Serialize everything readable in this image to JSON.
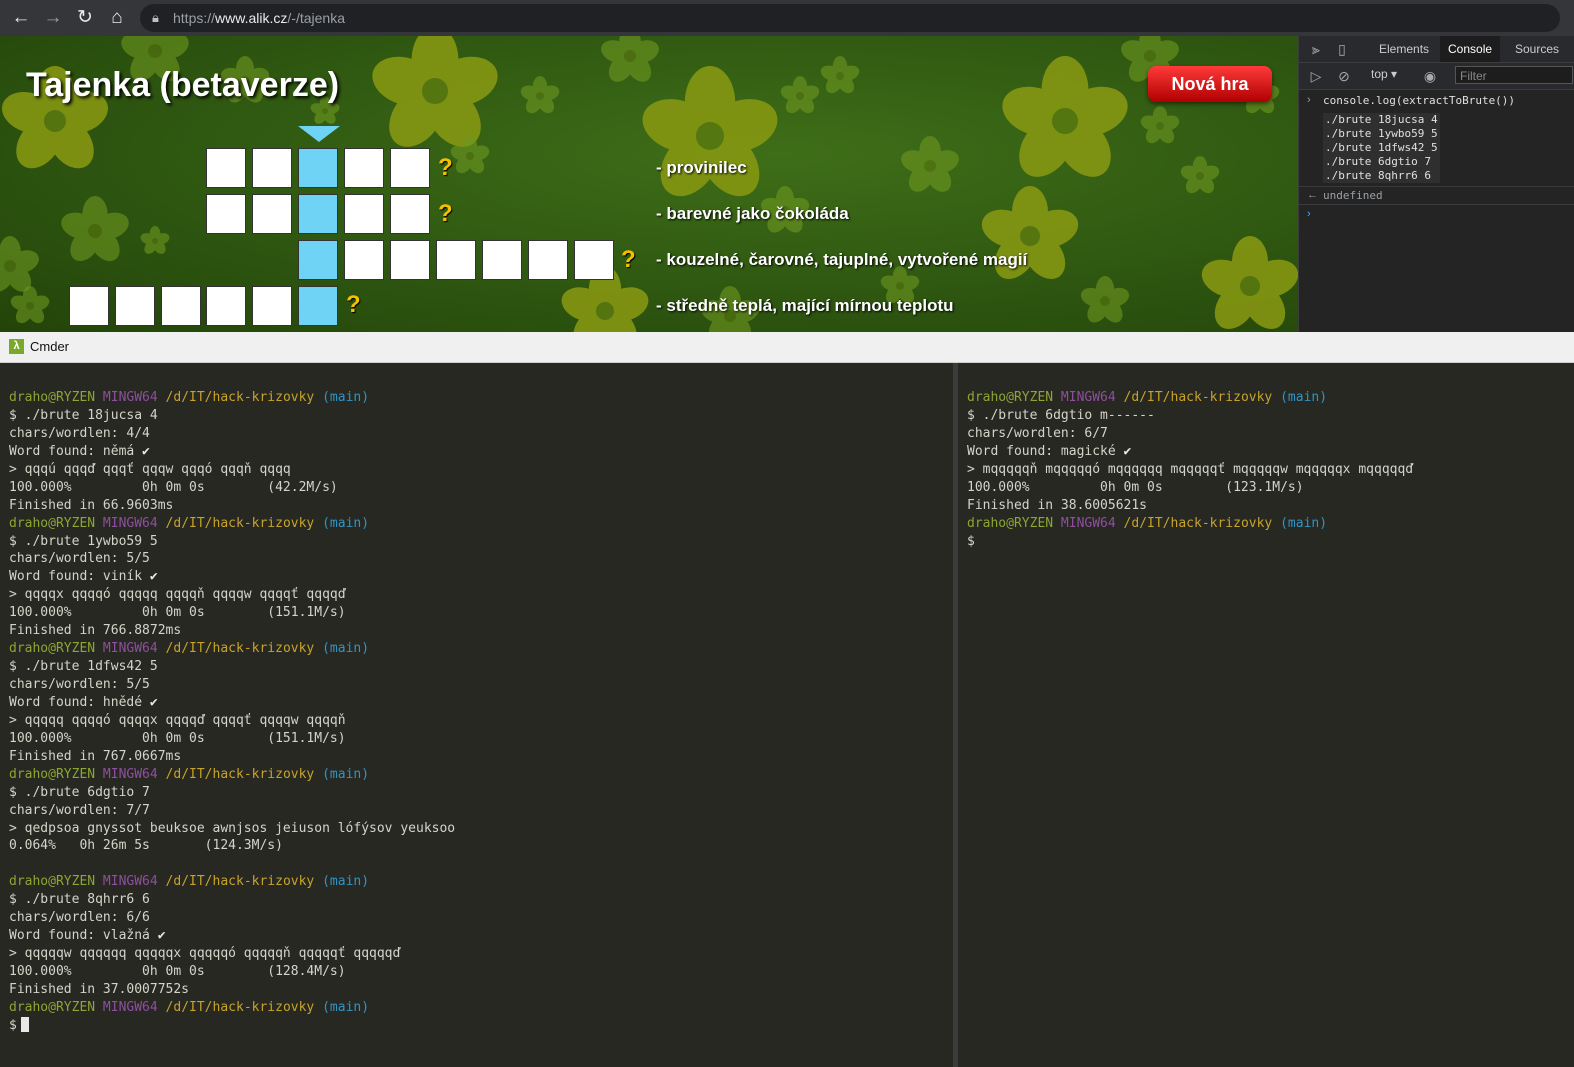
{
  "browser": {
    "url_prefix": "https://",
    "url_domain": "www.alik.cz",
    "url_path": "/-/tajenka"
  },
  "game": {
    "title": "Tajenka (betaverze)",
    "new_game_label": "Nová hra",
    "question_mark": "?",
    "clues": [
      "- provinilec",
      "- barevné jako čokoláda",
      "- kouzelné, čarovné, tajuplné, vytvořené magií",
      "- středně teplá, mající mírnou teplotu"
    ]
  },
  "devtools": {
    "tabs": [
      "Elements",
      "Console",
      "Sources"
    ],
    "active_tab": "Console",
    "context": "top",
    "filter_placeholder": "Filter",
    "command": "console.log(extractToBrute())",
    "output": [
      "./brute 18jucsa 4",
      "./brute 1ywbo59 5",
      "./brute 1dfws42 5",
      "./brute 6dgtio 7",
      "./brute 8qhrr6 6"
    ],
    "result": "undefined"
  },
  "cmder": {
    "title": "Cmder",
    "prompt": {
      "user": "draho@RYZEN",
      "host": "MINGW64",
      "path": "/d/IT/hack-krizovky",
      "branch": "(main)"
    },
    "left_pane": [
      {
        "type": "prompt"
      },
      {
        "type": "text",
        "text": "$ ./brute 18jucsa 4"
      },
      {
        "type": "text",
        "text": "chars/wordlen: 4/4"
      },
      {
        "type": "found",
        "text": "Word found: němá"
      },
      {
        "type": "text",
        "text": "> qqqú qqqď qqqť qqqw qqqó qqqň qqqq"
      },
      {
        "type": "text",
        "text": "100.000%         0h 0m 0s        (42.2M/s)"
      },
      {
        "type": "text",
        "text": "Finished in 66.9603ms"
      },
      {
        "type": "prompt"
      },
      {
        "type": "text",
        "text": "$ ./brute 1ywbo59 5"
      },
      {
        "type": "text",
        "text": "chars/wordlen: 5/5"
      },
      {
        "type": "found",
        "text": "Word found: viník"
      },
      {
        "type": "text",
        "text": "> qqqqx qqqqó qqqqq qqqqň qqqqw qqqqť qqqqď"
      },
      {
        "type": "text",
        "text": "100.000%         0h 0m 0s        (151.1M/s)"
      },
      {
        "type": "text",
        "text": "Finished in 766.8872ms"
      },
      {
        "type": "prompt"
      },
      {
        "type": "text",
        "text": "$ ./brute 1dfws42 5"
      },
      {
        "type": "text",
        "text": "chars/wordlen: 5/5"
      },
      {
        "type": "found",
        "text": "Word found: hnědé"
      },
      {
        "type": "text",
        "text": "> qqqqq qqqqó qqqqx qqqqď qqqqť qqqqw qqqqň"
      },
      {
        "type": "text",
        "text": "100.000%         0h 0m 0s        (151.1M/s)"
      },
      {
        "type": "text",
        "text": "Finished in 767.0667ms"
      },
      {
        "type": "prompt"
      },
      {
        "type": "text",
        "text": "$ ./brute 6dgtio 7"
      },
      {
        "type": "text",
        "text": "chars/wordlen: 7/7"
      },
      {
        "type": "text",
        "text": "> qedpsoa gnyssot beuksoe awnjsos jeiuson lófýsov yeuksoo"
      },
      {
        "type": "text",
        "text": "0.064%   0h 26m 5s       (124.3M/s)"
      },
      {
        "type": "text",
        "text": ""
      },
      {
        "type": "prompt"
      },
      {
        "type": "text",
        "text": "$ ./brute 8qhrr6 6"
      },
      {
        "type": "text",
        "text": "chars/wordlen: 6/6"
      },
      {
        "type": "found",
        "text": "Word found: vlažná"
      },
      {
        "type": "text",
        "text": "> qqqqqw qqqqqq qqqqqx qqqqqó qqqqqň qqqqqť qqqqqď"
      },
      {
        "type": "text",
        "text": "100.000%         0h 0m 0s        (128.4M/s)"
      },
      {
        "type": "text",
        "text": "Finished in 37.0007752s"
      },
      {
        "type": "prompt"
      },
      {
        "type": "cursor",
        "text": "$"
      }
    ],
    "right_pane": [
      {
        "type": "prompt"
      },
      {
        "type": "text",
        "text": "$ ./brute 6dgtio m------"
      },
      {
        "type": "text",
        "text": "chars/wordlen: 6/7"
      },
      {
        "type": "found",
        "text": "Word found: magické"
      },
      {
        "type": "text",
        "text": "> mqqqqqň mqqqqqó mqqqqqq mqqqqqť mqqqqqw mqqqqqx mqqqqqď"
      },
      {
        "type": "text",
        "text": "100.000%         0h 0m 0s        (123.1M/s)"
      },
      {
        "type": "text",
        "text": "Finished in 38.6005621s"
      },
      {
        "type": "prompt"
      },
      {
        "type": "text",
        "text": "$"
      }
    ]
  }
}
